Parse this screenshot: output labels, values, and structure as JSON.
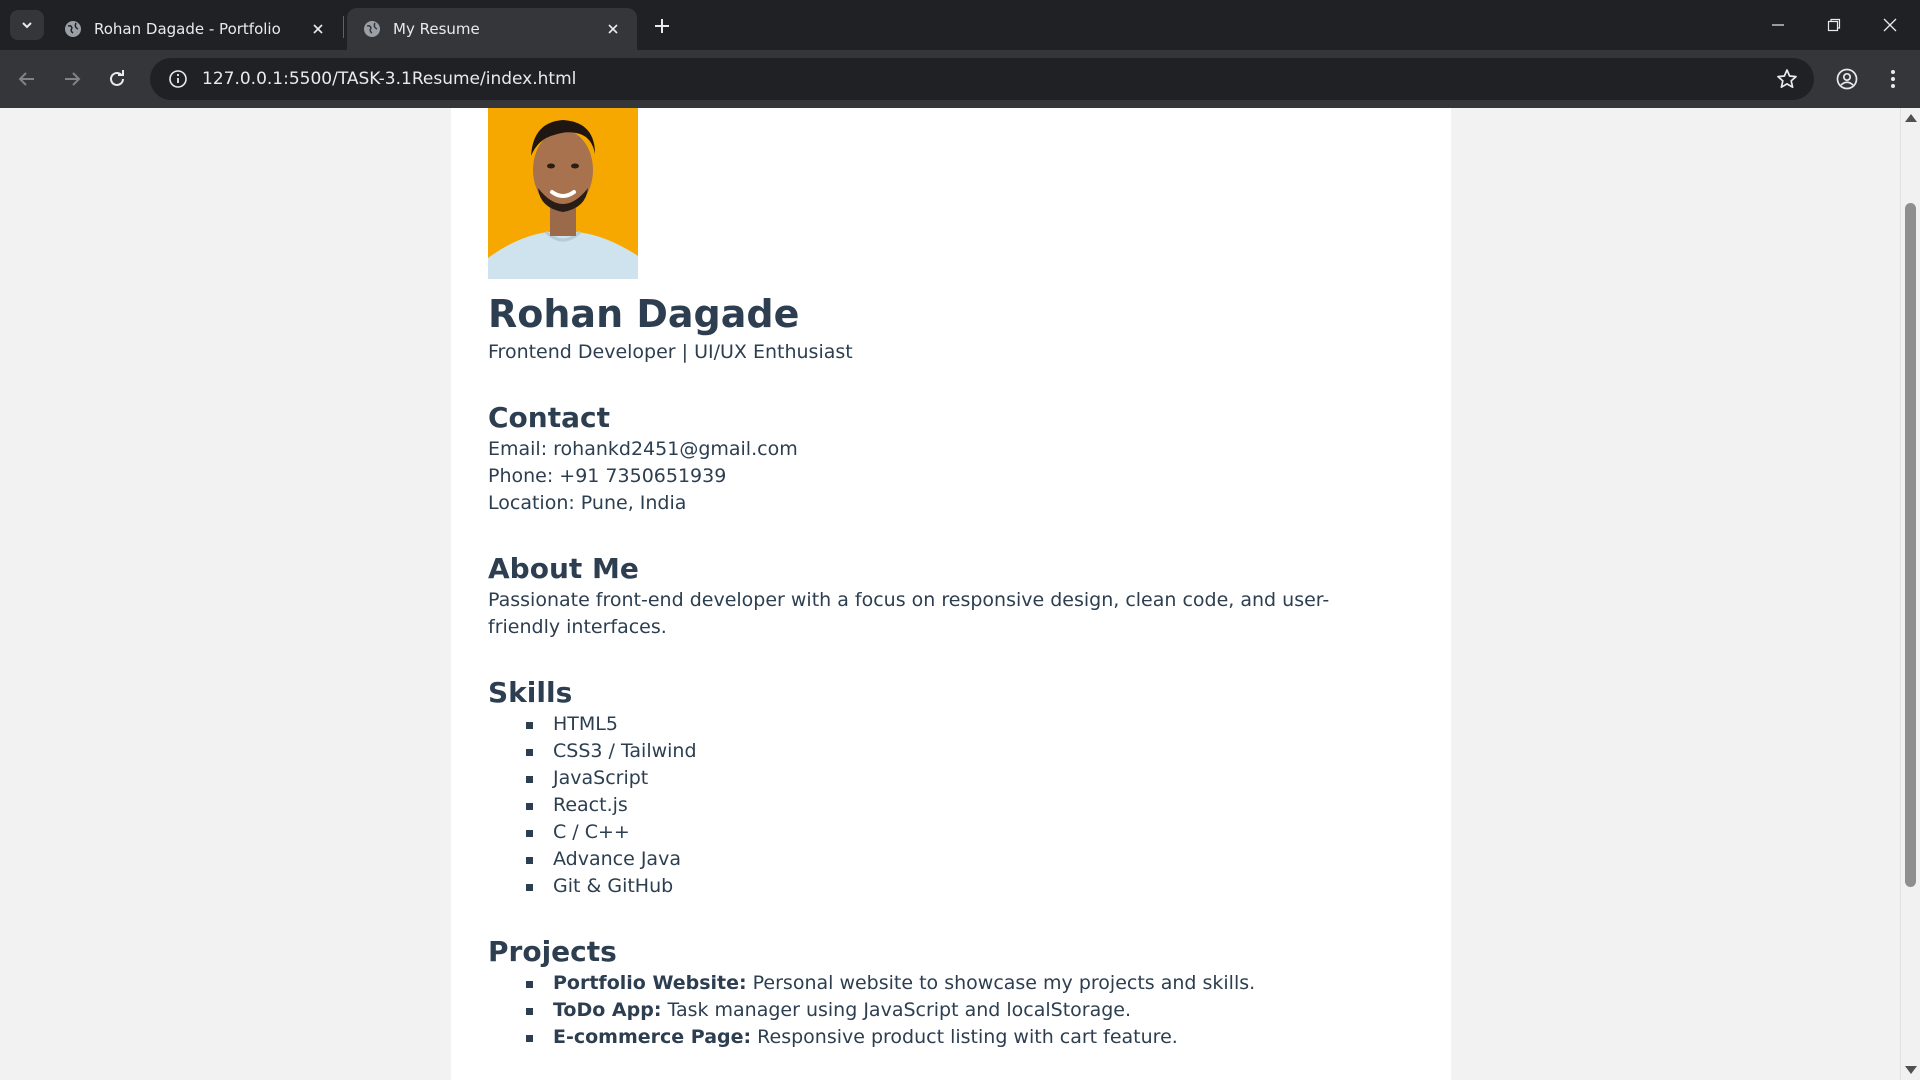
{
  "browser": {
    "tabs": [
      {
        "title": "Rohan Dagade - Portfolio",
        "active": false
      },
      {
        "title": "My Resume",
        "active": true
      }
    ],
    "url": "127.0.0.1:5500/TASK-3.1Resume/index.html"
  },
  "resume": {
    "name": "Rohan Dagade",
    "tagline": "Frontend Developer | UI/UX Enthusiast",
    "contact": {
      "heading": "Contact",
      "lines": [
        "Email: rohankd2451@gmail.com",
        "Phone: +91 7350651939",
        "Location: Pune, India"
      ]
    },
    "about": {
      "heading": "About Me",
      "text": "Passionate front-end developer with a focus on responsive design, clean code, and user-friendly interfaces."
    },
    "skills": {
      "heading": "Skills",
      "items": [
        "HTML5",
        "CSS3 / Tailwind",
        "JavaScript",
        "React.js",
        "C / C++",
        "Advance Java",
        "Git & GitHub"
      ]
    },
    "projects": {
      "heading": "Projects",
      "items": [
        {
          "name": "Portfolio Website:",
          "desc": " Personal website to showcase my projects and skills."
        },
        {
          "name": "ToDo App:",
          "desc": " Task manager using JavaScript and localStorage."
        },
        {
          "name": "E-commerce Page:",
          "desc": " Responsive product listing with cart feature."
        }
      ]
    }
  },
  "colors": {
    "heading": "#2c3e50",
    "photo_bg": "#f7a800",
    "chrome_dark": "#202124",
    "chrome_mid": "#35363a"
  }
}
